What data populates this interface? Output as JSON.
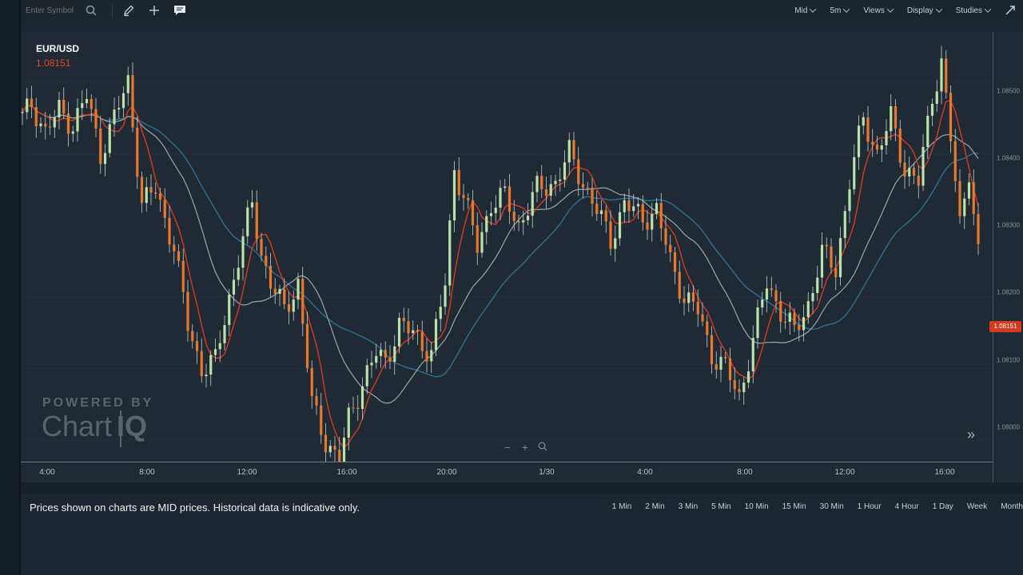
{
  "toolbar": {
    "symbol_placeholder": "Enter Symbol",
    "icons": [
      "search-icon",
      "pencil-icon",
      "crosshair-plus-icon",
      "comment-icon",
      "expand-icon"
    ],
    "menus": [
      {
        "label": "Mid"
      },
      {
        "label": "5m"
      },
      {
        "label": "Views"
      },
      {
        "label": "Display"
      },
      {
        "label": "Studies"
      }
    ]
  },
  "chart": {
    "symbol": "EUR/USD",
    "last_price": "1.08151",
    "price_tag": "1.08151",
    "watermark_powered": "POWERED BY",
    "watermark_brand_a": "Chart",
    "watermark_brand_b": "IQ",
    "zoom_out": "−",
    "zoom_in": "+",
    "forward": "»"
  },
  "chart_data": {
    "type": "candlestick",
    "x_tick_labels": [
      "4:00",
      "8:00",
      "12:00",
      "16:00",
      "20:00",
      "1/30",
      "4:00",
      "8:00",
      "12:00",
      "16:00"
    ],
    "y_tick_labels": [
      "1.08500",
      "1.08400",
      "1.08300",
      "1.08200",
      "1.08100",
      "1.08000"
    ],
    "ylim": [
      1.0797,
      1.0857
    ],
    "colors": {
      "up": "#b8e2a8",
      "down": "#e8792c",
      "ma_fast": "#d43a1e",
      "ma_mid": "#9aa8ac",
      "ma_slow": "#2e6f93"
    },
    "price_anchors": [
      [
        0,
        1.0845
      ],
      [
        2,
        1.0847
      ],
      [
        5,
        1.0843
      ],
      [
        8,
        1.0846
      ],
      [
        11,
        1.0844
      ],
      [
        14,
        1.0848
      ],
      [
        17,
        1.084
      ],
      [
        20,
        1.0845
      ],
      [
        23,
        1.085
      ],
      [
        26,
        1.0833
      ],
      [
        29,
        1.0835
      ],
      [
        33,
        1.0827
      ],
      [
        36,
        1.0816
      ],
      [
        39,
        1.081
      ],
      [
        42,
        1.0811
      ],
      [
        45,
        1.082
      ],
      [
        48,
        1.0828
      ],
      [
        50,
        1.0833
      ],
      [
        52,
        1.0826
      ],
      [
        54,
        1.0822
      ],
      [
        57,
        1.0818
      ],
      [
        60,
        1.0822
      ],
      [
        63,
        1.0805
      ],
      [
        66,
        1.08
      ],
      [
        69,
        1.0797
      ],
      [
        71,
        1.0803
      ],
      [
        74,
        1.0808
      ],
      [
        77,
        1.0812
      ],
      [
        79,
        1.0811
      ],
      [
        82,
        1.0816
      ],
      [
        85,
        1.0815
      ],
      [
        89,
        1.0812
      ],
      [
        92,
        1.0822
      ],
      [
        94,
        1.0838
      ],
      [
        96,
        1.0834
      ],
      [
        99,
        1.0827
      ],
      [
        102,
        1.0833
      ],
      [
        105,
        1.0834
      ],
      [
        108,
        1.083
      ],
      [
        112,
        1.0835
      ],
      [
        116,
        1.0836
      ],
      [
        119,
        1.084
      ],
      [
        122,
        1.0836
      ],
      [
        125,
        1.0832
      ],
      [
        128,
        1.0828
      ],
      [
        131,
        1.0833
      ],
      [
        135,
        1.0831
      ],
      [
        138,
        1.0832
      ],
      [
        141,
        1.0825
      ],
      [
        144,
        1.082
      ],
      [
        147,
        1.0818
      ],
      [
        150,
        1.0812
      ],
      [
        153,
        1.081
      ],
      [
        156,
        1.0806
      ],
      [
        159,
        1.0814
      ],
      [
        162,
        1.0822
      ],
      [
        165,
        1.0818
      ],
      [
        168,
        1.0815
      ],
      [
        171,
        1.0819
      ],
      [
        174,
        1.0826
      ],
      [
        177,
        1.0824
      ],
      [
        180,
        1.0836
      ],
      [
        183,
        1.0845
      ],
      [
        186,
        1.084
      ],
      [
        189,
        1.0845
      ],
      [
        192,
        1.0838
      ],
      [
        195,
        1.0836
      ],
      [
        198,
        1.0848
      ],
      [
        200,
        1.0853
      ],
      [
        202,
        1.0842
      ],
      [
        204,
        1.083
      ],
      [
        206,
        1.0838
      ],
      [
        208,
        1.0826
      ]
    ]
  },
  "footer": {
    "disclaimer": "Prices shown on charts are MID prices. Historical data is indicative only.",
    "periods": [
      "1 Min",
      "2 Min",
      "3 Min",
      "5 Min",
      "10 Min",
      "15 Min",
      "30 Min",
      "1 Hour",
      "4 Hour",
      "1 Day",
      "Week",
      "Month"
    ]
  }
}
